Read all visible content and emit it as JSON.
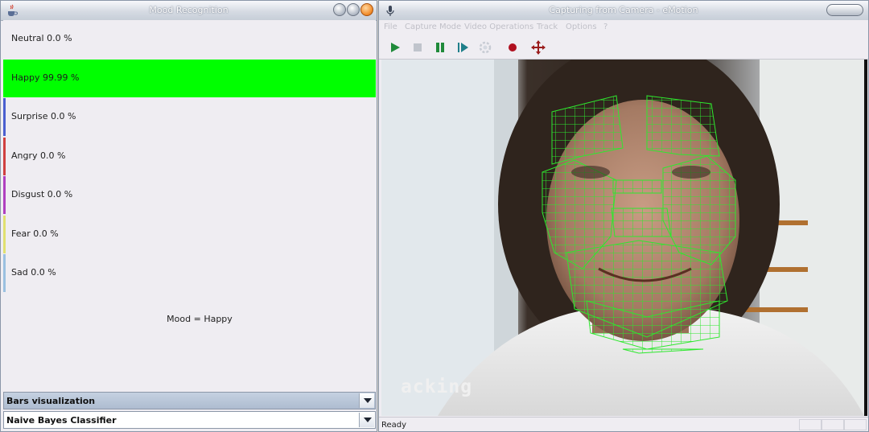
{
  "left_window": {
    "title": "Mood Recognition",
    "moods": [
      {
        "label": "Neutral 0.0 %",
        "value": 0.0,
        "color": "#efedf2"
      },
      {
        "label": "Happy 99.99 %",
        "value": 99.99,
        "color": "#00ff00"
      },
      {
        "label": "Surprise 0.0 %",
        "value": 0.0,
        "color": "#4a5fd0"
      },
      {
        "label": "Angry 0.0 %",
        "value": 0.0,
        "color": "#d04040"
      },
      {
        "label": "Disgust 0.0 %",
        "value": 0.0,
        "color": "#b040c0"
      },
      {
        "label": "Fear 0.0 %",
        "value": 0.0,
        "color": "#e0e070"
      },
      {
        "label": "Sad 0.0 %",
        "value": 0.0,
        "color": "#9ac0e0"
      }
    ],
    "mood_result": "Mood = Happy",
    "visualization_select": "Bars visualization",
    "classifier_select": "Naive Bayes Classifier"
  },
  "right_window": {
    "title": "Capturing from Camera - eMotion",
    "menu": [
      "File",
      "Capture Mode",
      "Video Operations",
      "Track",
      "Options",
      "?"
    ],
    "toolbar_icons": [
      "play-icon",
      "stop-icon",
      "pause-icon",
      "step-forward-icon",
      "settings-icon",
      "record-icon",
      "move-icon"
    ],
    "video_overlay_text": "acking",
    "status": "Ready"
  },
  "colors": {
    "mesh": "#2ee82e",
    "happy_bar": "#00ff00",
    "accent": "#f28d2c"
  }
}
